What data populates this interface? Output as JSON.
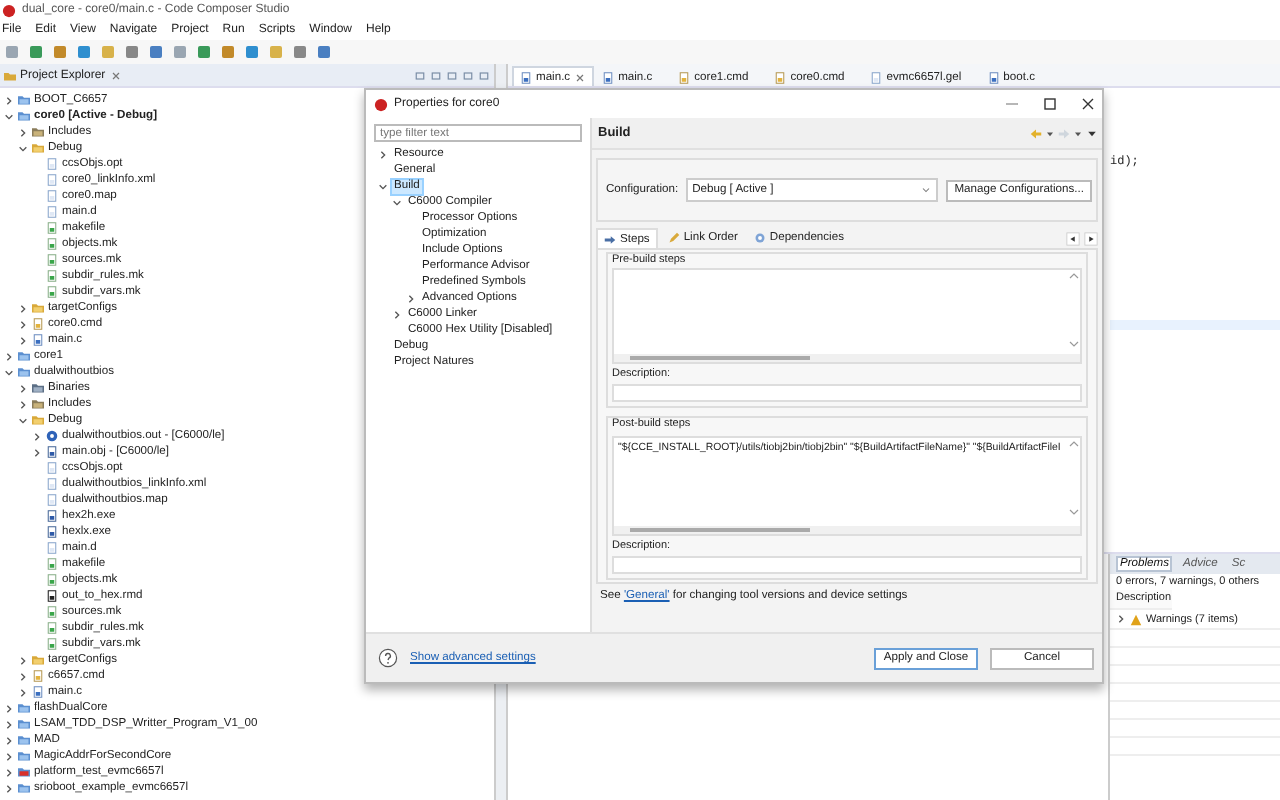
{
  "window": {
    "title": "dual_core - core0/main.c - Code Composer Studio"
  },
  "menu": [
    "File",
    "Edit",
    "View",
    "Navigate",
    "Project",
    "Run",
    "Scripts",
    "Window",
    "Help"
  ],
  "explorer": {
    "title": "Project Explorer",
    "tree": [
      {
        "label": "BOOT_C6657",
        "kind": "project",
        "expanded": false
      },
      {
        "label": "core0 [Active - Debug]",
        "kind": "active_project",
        "expanded": true,
        "children": [
          {
            "label": "Includes",
            "kind": "includes",
            "expanded": false
          },
          {
            "label": "Debug",
            "kind": "folder",
            "expanded": true,
            "children": [
              {
                "label": "ccsObjs.opt",
                "kind": "doc"
              },
              {
                "label": "core0_linkInfo.xml",
                "kind": "doc"
              },
              {
                "label": "core0.map",
                "kind": "doc"
              },
              {
                "label": "main.d",
                "kind": "doc"
              },
              {
                "label": "makefile",
                "kind": "make"
              },
              {
                "label": "objects.mk",
                "kind": "make"
              },
              {
                "label": "sources.mk",
                "kind": "make"
              },
              {
                "label": "subdir_rules.mk",
                "kind": "make"
              },
              {
                "label": "subdir_vars.mk",
                "kind": "make"
              }
            ]
          },
          {
            "label": "targetConfigs",
            "kind": "folder",
            "expanded": false
          },
          {
            "label": "core0.cmd",
            "kind": "cmd",
            "expanded": false
          },
          {
            "label": "main.c",
            "kind": "source",
            "expanded": false
          }
        ]
      },
      {
        "label": "core1",
        "kind": "project",
        "expanded": false
      },
      {
        "label": "dualwithoutbios",
        "kind": "project",
        "expanded": true,
        "children": [
          {
            "label": "Binaries",
            "kind": "binaries",
            "expanded": false
          },
          {
            "label": "Includes",
            "kind": "includes",
            "expanded": false
          },
          {
            "label": "Debug",
            "kind": "folder",
            "expanded": true,
            "children": [
              {
                "label": "dualwithoutbios.out - [C6000/le]",
                "kind": "binary",
                "expanded": false
              },
              {
                "label": "main.obj - [C6000/le]",
                "kind": "exe",
                "expanded": false
              },
              {
                "label": "ccsObjs.opt",
                "kind": "doc"
              },
              {
                "label": "dualwithoutbios_linkInfo.xml",
                "kind": "doc"
              },
              {
                "label": "dualwithoutbios.map",
                "kind": "doc"
              },
              {
                "label": "hex2h.exe",
                "kind": "exe"
              },
              {
                "label": "hexlx.exe",
                "kind": "exe"
              },
              {
                "label": "main.d",
                "kind": "doc"
              },
              {
                "label": "makefile",
                "kind": "make"
              },
              {
                "label": "objects.mk",
                "kind": "make"
              },
              {
                "label": "out_to_hex.rmd",
                "kind": "script"
              },
              {
                "label": "sources.mk",
                "kind": "make"
              },
              {
                "label": "subdir_rules.mk",
                "kind": "make"
              },
              {
                "label": "subdir_vars.mk",
                "kind": "make"
              }
            ]
          },
          {
            "label": "targetConfigs",
            "kind": "folder",
            "expanded": false
          },
          {
            "label": "c6657.cmd",
            "kind": "cmd",
            "expanded": false
          },
          {
            "label": "main.c",
            "kind": "source",
            "expanded": false
          }
        ]
      },
      {
        "label": "flashDualCore",
        "kind": "project",
        "expanded": false
      },
      {
        "label": "LSAM_TDD_DSP_Writter_Program_V1_00",
        "kind": "project",
        "expanded": false
      },
      {
        "label": "MAD",
        "kind": "project",
        "expanded": false
      },
      {
        "label": "MagicAddrForSecondCore",
        "kind": "project",
        "expanded": false
      },
      {
        "label": "platform_test_evmc6657l",
        "kind": "project_error",
        "expanded": false
      },
      {
        "label": "srioboot_example_evmc6657l",
        "kind": "project",
        "expanded": false
      }
    ]
  },
  "editor": {
    "tabs": [
      {
        "label": "main.c",
        "kind": "source",
        "selected": true
      },
      {
        "label": "main.c",
        "kind": "source",
        "selected": false
      },
      {
        "label": "core1.cmd",
        "kind": "cmd",
        "selected": false
      },
      {
        "label": "core0.cmd",
        "kind": "cmd",
        "selected": false
      },
      {
        "label": "evmc6657l.gel",
        "kind": "doc",
        "selected": false
      },
      {
        "label": "boot.c",
        "kind": "source",
        "selected": false
      }
    ],
    "line": "id);"
  },
  "problems": {
    "tabs": [
      {
        "label": "Problems",
        "selected": true
      },
      {
        "label": "Advice",
        "selected": false
      },
      {
        "label": "Sc",
        "selected": false
      }
    ],
    "summary": "0 errors, 7 warnings, 0 others",
    "column": "Description",
    "rows": [
      {
        "label": "Warnings (7 items)",
        "expanded": false
      }
    ]
  },
  "dialog": {
    "title": "Properties for core0",
    "nav": {
      "placeholder": "type filter text",
      "items": [
        {
          "label": "Resource",
          "selected": false,
          "expanded": false
        },
        {
          "label": "General",
          "selected": false
        },
        {
          "label": "Build",
          "selected": true,
          "expanded": true,
          "children": [
            {
              "label": "C6000 Compiler",
              "selected": false,
              "expanded": true,
              "children": [
                {
                  "label": "Processor Options",
                  "selected": false
                },
                {
                  "label": "Optimization",
                  "selected": false
                },
                {
                  "label": "Include Options",
                  "selected": false
                },
                {
                  "label": "Performance Advisor",
                  "selected": false
                },
                {
                  "label": "Predefined Symbols",
                  "selected": false
                },
                {
                  "label": "Advanced Options",
                  "selected": false,
                  "expanded": false
                }
              ]
            },
            {
              "label": "C6000 Linker",
              "selected": false,
              "expanded": false
            },
            {
              "label": "C6000 Hex Utility  [Disabled]",
              "selected": false
            }
          ]
        },
        {
          "label": "Debug",
          "selected": false
        },
        {
          "label": "Project Natures",
          "selected": false
        }
      ]
    },
    "page_title": "Build",
    "configuration": {
      "label": "Configuration:",
      "value": "Debug  [ Active ]",
      "button": "Manage Configurations..."
    },
    "tabs": [
      {
        "label": "Steps",
        "selected": true
      },
      {
        "label": "Link Order",
        "selected": false
      },
      {
        "label": "Dependencies",
        "selected": false
      }
    ],
    "pre_build": {
      "title": "Pre-build steps",
      "description_label": "Description:"
    },
    "post_build": {
      "title": "Post-build steps",
      "command": "\"${CCE_INSTALL_ROOT}/utils/tiobj2bin/tiobj2bin\" \"${BuildArtifactFileName}\" \"${BuildArtifactFileI",
      "description_label": "Description:"
    },
    "note_parts": {
      "before": "See ",
      "link": "'General'",
      "after": " for changing tool versions and device settings"
    },
    "advanced_link": "Show advanced settings",
    "buttons": [
      "Apply and Close",
      "Cancel"
    ]
  }
}
